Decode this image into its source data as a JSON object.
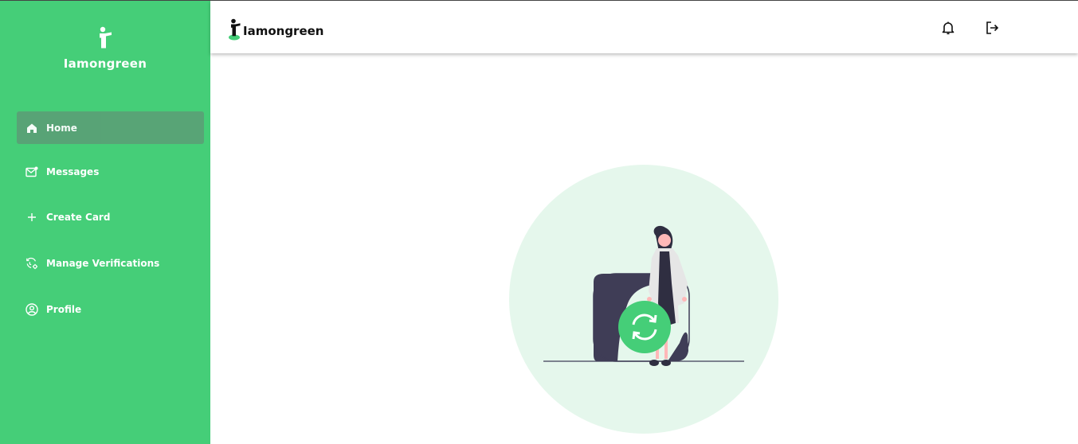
{
  "app": {
    "brand_name": "Iamongreen",
    "accent_color": "#45ce78"
  },
  "sidebar": {
    "items": [
      {
        "label": "Home",
        "icon": "home-icon",
        "active": true
      },
      {
        "label": "Messages",
        "icon": "mail-icon",
        "active": false
      },
      {
        "label": "Create Card",
        "icon": "plus-icon",
        "active": false
      },
      {
        "label": "Manage Verifications",
        "icon": "verification-settings-icon",
        "active": false
      },
      {
        "label": "Profile",
        "icon": "user-circle-icon",
        "active": false
      }
    ]
  },
  "header": {
    "brand_name": "Iamongreen",
    "icons": [
      "bell-icon",
      "logout-icon"
    ]
  },
  "main": {
    "illustration": "woman-standing-with-sync-icon-illustration"
  }
}
